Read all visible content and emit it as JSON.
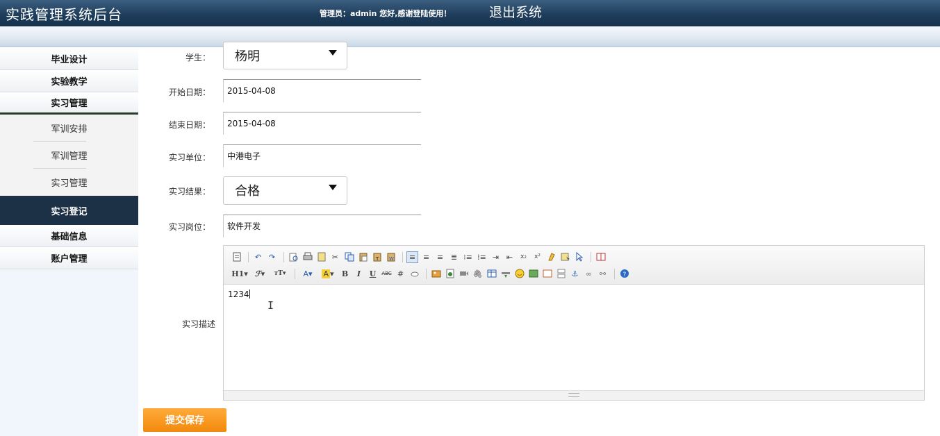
{
  "header": {
    "app_title": "实践管理系统后台",
    "welcome": "管理员：admin 您好,感谢登陆使用！",
    "logout": "退出系统"
  },
  "sidebar": {
    "groups_top": [
      "毕业设计",
      "实验教学",
      "实习管理"
    ],
    "sub_items": [
      "军训安排",
      "军训管理",
      "实习管理"
    ],
    "active_item": "实习登记",
    "groups_bottom": [
      "基础信息",
      "账户管理"
    ]
  },
  "form": {
    "student": {
      "label": "学生：",
      "value": "杨明"
    },
    "start_date": {
      "label": "开始日期：",
      "value": "2015-04-08"
    },
    "end_date": {
      "label": "结束日期：",
      "value": "2015-04-08"
    },
    "company": {
      "label": "实习单位：",
      "value": "中港电子"
    },
    "result": {
      "label": "实习结果：",
      "value": "合格"
    },
    "position": {
      "label": "实习岗位：",
      "value": "软件开发"
    },
    "description": {
      "label": "实习描述",
      "value": "1234"
    },
    "submit_label": "提交保存"
  },
  "editor_toolbar": {
    "heading_label": "H1",
    "font_label": "ℱ",
    "size_label": "тT"
  },
  "colors": {
    "header_bg": "#1f3e5c",
    "active_menu_bg": "#1c3145",
    "submit_bg": "#f28a0c"
  }
}
